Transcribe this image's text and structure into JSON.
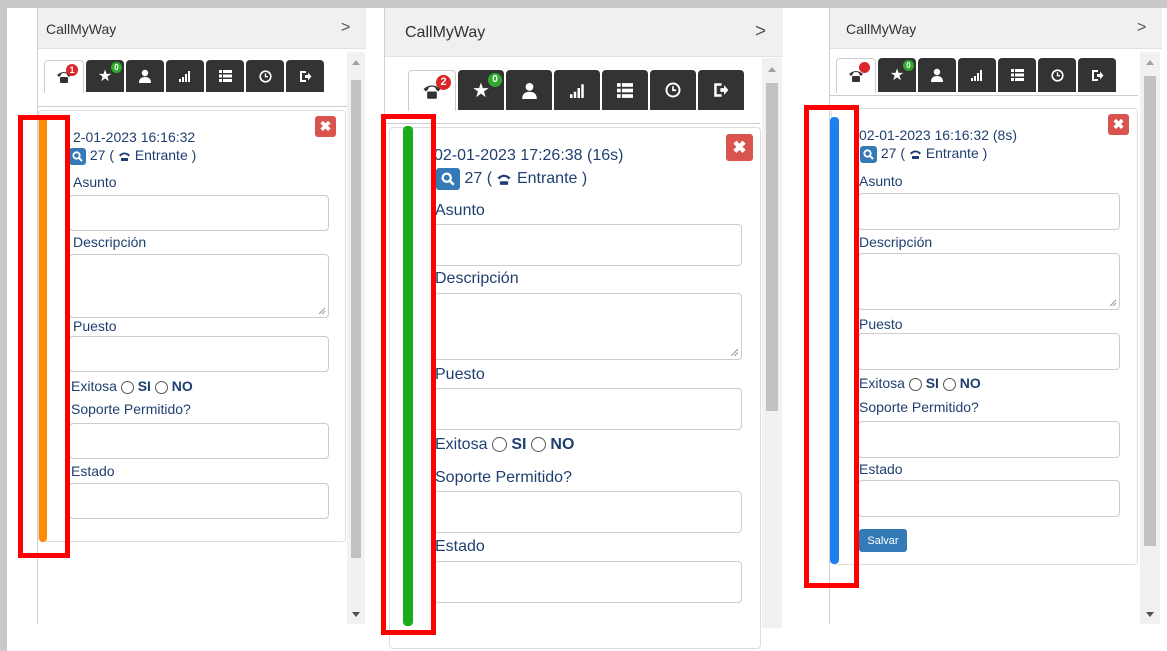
{
  "panels": [
    {
      "title": "CallMyWay",
      "badges": {
        "calls": "1",
        "favorites": "0"
      },
      "datetime": "2-01-2023 16:16:32",
      "count": "27",
      "direction": "Entrante",
      "labels": {
        "asunto": "Asunto",
        "descripcion": "Descripción",
        "puesto": "Puesto",
        "exitosa": "Exitosa",
        "si": "SI",
        "no": "NO",
        "soporte": "Soporte Permitido?",
        "estado": "Estado"
      },
      "bar_color": "#ff8c00"
    },
    {
      "title": "CallMyWay",
      "badges": {
        "calls": "2",
        "favorites": "0"
      },
      "datetime": "02-01-2023 17:26:38 (16s)",
      "count": "27",
      "direction": "Entrante",
      "labels": {
        "asunto": "Asunto",
        "descripcion": "Descripción",
        "puesto": "Puesto",
        "exitosa": "Exitosa",
        "si": "SI",
        "no": "NO",
        "soporte": "Soporte Permitido?",
        "estado": "Estado"
      },
      "bar_color": "#1aaa1a"
    },
    {
      "title": "CallMyWay",
      "badges": {
        "calls": "",
        "favorites": "0"
      },
      "datetime": "02-01-2023 16:16:32 (8s)",
      "count": "27",
      "direction": "Entrante",
      "labels": {
        "asunto": "Asunto",
        "descripcion": "Descripción",
        "puesto": "Puesto",
        "exitosa": "Exitosa",
        "si": "SI",
        "no": "NO",
        "soporte": "Soporte Permitido?",
        "estado": "Estado"
      },
      "save_label": "Salvar",
      "bar_color": "#1e7ff0"
    }
  ],
  "colors": {
    "highlight_box": "#ff0000",
    "close_button": "#d9534f",
    "primary_button": "#337ab7",
    "tab_dark": "#333333",
    "label_text": "#1f3f70"
  }
}
